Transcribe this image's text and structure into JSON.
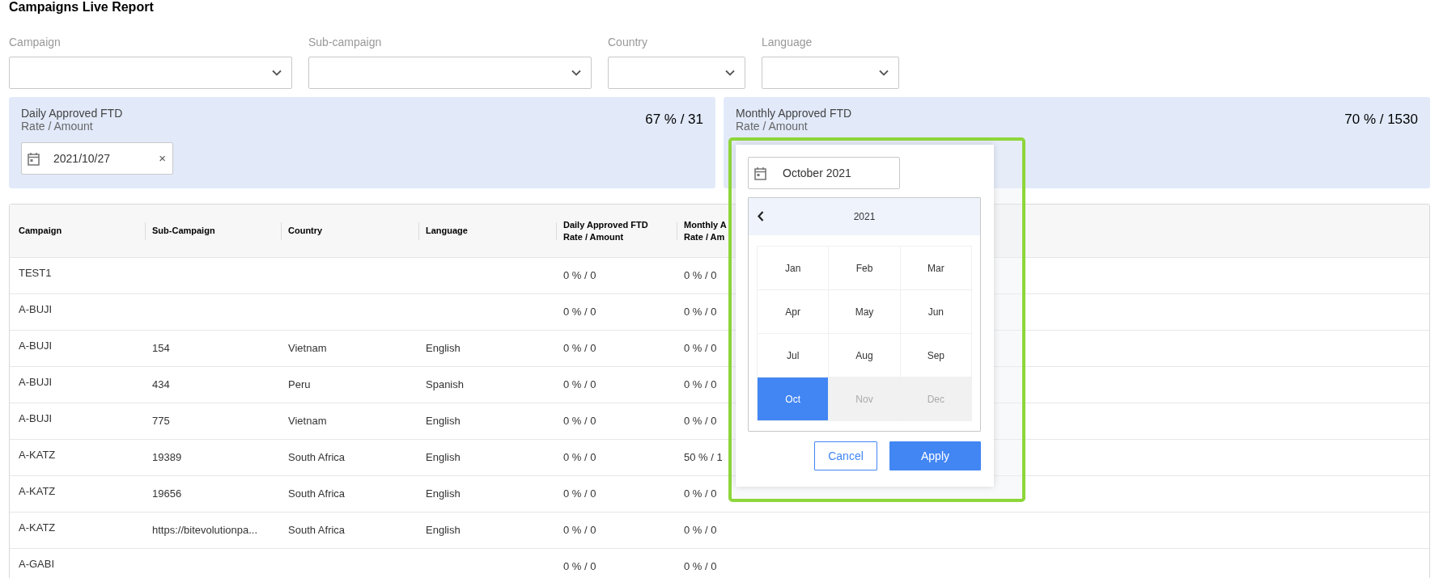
{
  "title": "Campaigns Live Report",
  "filters": [
    {
      "label": "Campaign"
    },
    {
      "label": "Sub-campaign"
    },
    {
      "label": "Country"
    },
    {
      "label": "Language"
    }
  ],
  "cards": [
    {
      "title": "Daily Approved FTD",
      "subtitle": "Rate / Amount",
      "value": "67 % / 31",
      "date": "2021/10/27",
      "clear": "×"
    },
    {
      "title": "Monthly Approved FTD",
      "subtitle": "Rate / Amount",
      "value": "70 % / 1530"
    }
  ],
  "table": {
    "columns": [
      {
        "lines": [
          "Campaign"
        ]
      },
      {
        "lines": [
          "Sub-Campaign"
        ]
      },
      {
        "lines": [
          "Country"
        ]
      },
      {
        "lines": [
          "Language"
        ]
      },
      {
        "lines": [
          "Daily Approved FTD",
          "Rate / Amount"
        ]
      },
      {
        "lines": [
          "Monthly A",
          "Rate / Am"
        ]
      }
    ],
    "rows": [
      {
        "campaign": "TEST1",
        "daily": "0 % / 0",
        "monthly": "0 % / 0"
      },
      {
        "campaign": "A-BUJI",
        "daily": "0 % / 0",
        "monthly": "0 % / 0"
      },
      {
        "campaign": "A-BUJI",
        "sub_campaign": "154",
        "country": "Vietnam",
        "language": "English",
        "daily": "0 % / 0",
        "monthly": "0 % / 0"
      },
      {
        "campaign": "A-BUJI",
        "sub_campaign": "434",
        "country": "Peru",
        "language": "Spanish",
        "daily": "0 % / 0",
        "monthly": "0 % / 0"
      },
      {
        "campaign": "A-BUJI",
        "sub_campaign": "775",
        "country": "Vietnam",
        "language": "English",
        "daily": "0 % / 0",
        "monthly": "0 % / 0"
      },
      {
        "campaign": "A-KATZ",
        "sub_campaign": "19389",
        "country": "South Africa",
        "language": "English",
        "daily": "0 % / 0",
        "monthly": "50 % / 1"
      },
      {
        "campaign": "A-KATZ",
        "sub_campaign": "19656",
        "country": "South Africa",
        "language": "English",
        "daily": "0 % / 0",
        "monthly": "0 % / 0"
      },
      {
        "campaign": "A-KATZ",
        "sub_campaign": "https://bitevolutionpa...",
        "country": "South Africa",
        "language": "English",
        "daily": "0 % / 0",
        "monthly": "0 % / 0"
      },
      {
        "campaign": "A-GABI",
        "daily": "0 % / 0",
        "monthly": "0 % / 0"
      }
    ]
  },
  "month_picker": {
    "value": "October 2021",
    "year": "2021",
    "months": [
      {
        "label": "Jan",
        "selected": false,
        "disabled": false
      },
      {
        "label": "Feb",
        "selected": false,
        "disabled": false
      },
      {
        "label": "Mar",
        "selected": false,
        "disabled": false
      },
      {
        "label": "Apr",
        "selected": false,
        "disabled": false
      },
      {
        "label": "May",
        "selected": false,
        "disabled": false
      },
      {
        "label": "Jun",
        "selected": false,
        "disabled": false
      },
      {
        "label": "Jul",
        "selected": false,
        "disabled": false
      },
      {
        "label": "Aug",
        "selected": false,
        "disabled": false
      },
      {
        "label": "Sep",
        "selected": false,
        "disabled": false
      },
      {
        "label": "Oct",
        "selected": true,
        "disabled": false
      },
      {
        "label": "Nov",
        "selected": false,
        "disabled": true
      },
      {
        "label": "Dec",
        "selected": false,
        "disabled": true
      }
    ],
    "buttons": [
      {
        "label": "Cancel",
        "kind": "secondary"
      },
      {
        "label": "Apply",
        "kind": "primary"
      }
    ]
  }
}
